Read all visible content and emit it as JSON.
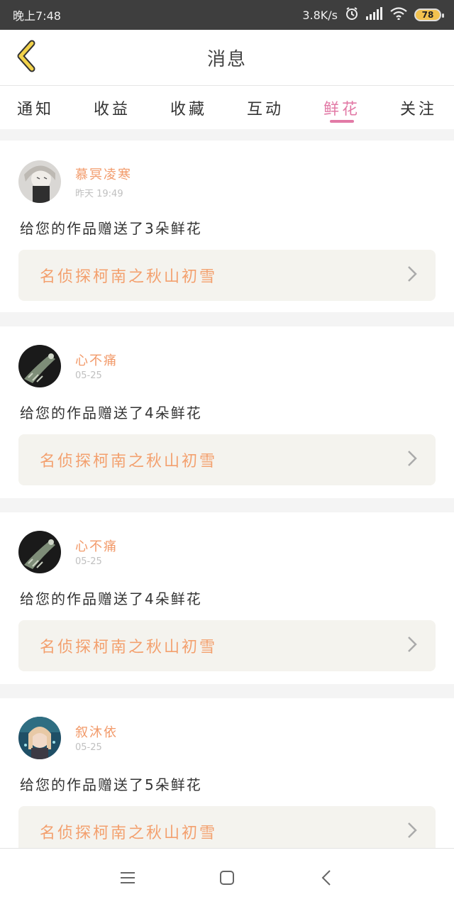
{
  "status_bar": {
    "time": "晚上7:48",
    "network_speed": "3.8K/s",
    "battery": "78",
    "icons": [
      "alarm-icon",
      "signal-icon",
      "wifi-icon",
      "battery-icon"
    ]
  },
  "header": {
    "title": "消息",
    "back_icon": "chevron-left-icon"
  },
  "tabs": [
    {
      "label": "通知",
      "active": false
    },
    {
      "label": "收益",
      "active": false
    },
    {
      "label": "收藏",
      "active": false
    },
    {
      "label": "互动",
      "active": false
    },
    {
      "label": "鲜花",
      "active": true
    },
    {
      "label": "关注",
      "active": false
    }
  ],
  "feed": [
    {
      "username": "慕冥凌寒",
      "time": "昨天 19:49",
      "message": "给您的作品赠送了3朵鲜花",
      "work_title": "名侦探柯南之秋山初雪"
    },
    {
      "username": "心不痛",
      "time": "05-25",
      "message": "给您的作品赠送了4朵鲜花",
      "work_title": "名侦探柯南之秋山初雪"
    },
    {
      "username": "心不痛",
      "time": "05-25",
      "message": "给您的作品赠送了4朵鲜花",
      "work_title": "名侦探柯南之秋山初雪"
    },
    {
      "username": "叙沐依",
      "time": "05-25",
      "message": "给您的作品赠送了5朵鲜花",
      "work_title": "名侦探柯南之秋山初雪"
    }
  ],
  "colors": {
    "accent_pink": "#e27aa6",
    "username_orange": "#f29a6a",
    "link_orange": "#f3a06e",
    "link_bg": "#f4f3ee",
    "status_bg": "#3e3e3e",
    "back_icon_yellow": "#f2d24a"
  },
  "navigation": {
    "icons": [
      "menu-icon",
      "home-square-icon",
      "back-triangle-icon"
    ]
  }
}
